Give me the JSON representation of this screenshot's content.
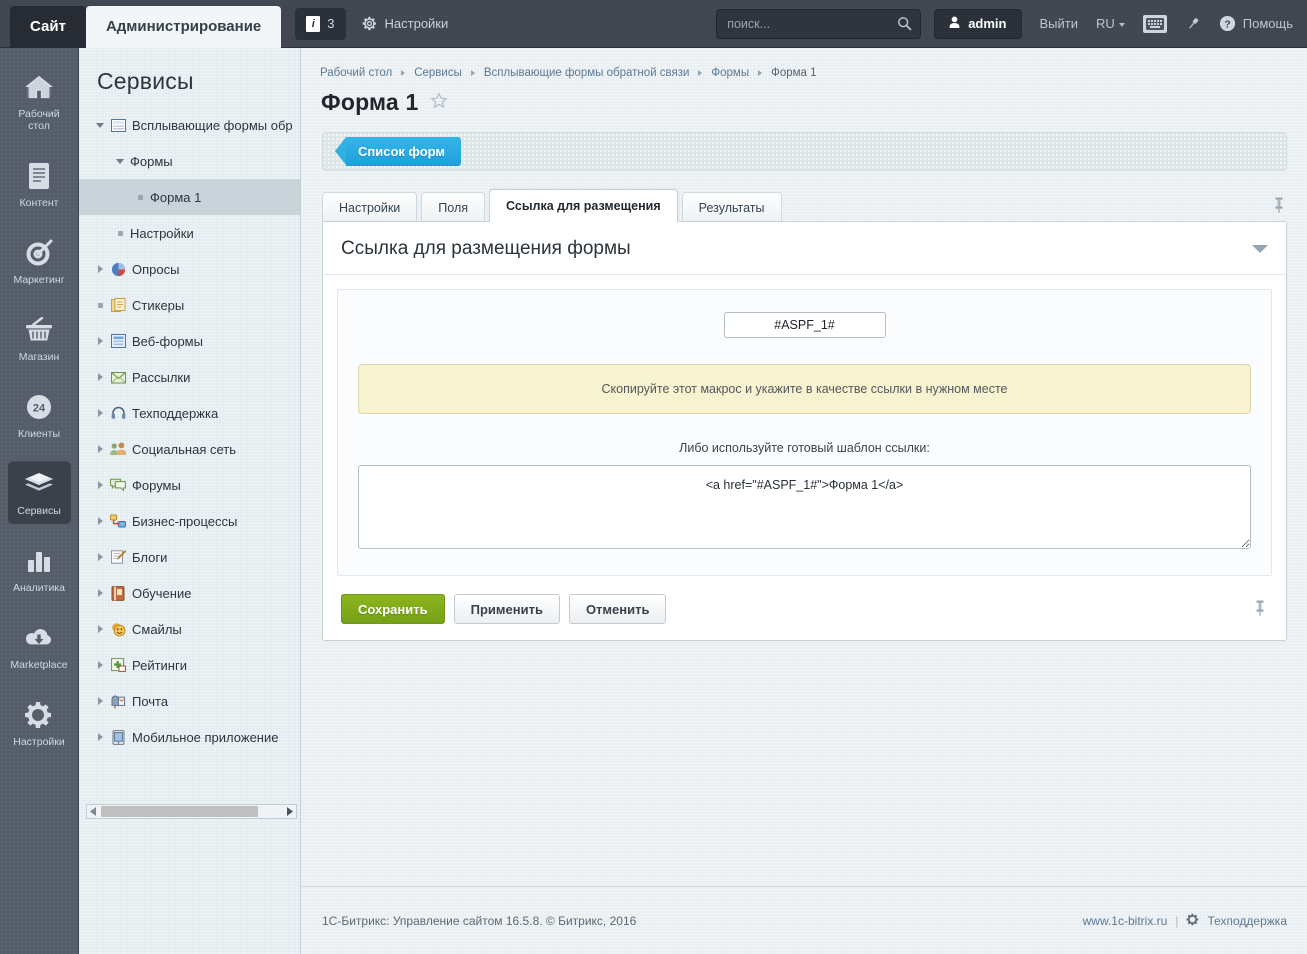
{
  "topbar": {
    "site_tab": "Сайт",
    "admin_tab": "Администрирование",
    "notify_count": "3",
    "notify_icon": "info-icon",
    "settings_label": "Настройки",
    "settings_icon": "gear-icon",
    "search_placeholder": "поиск...",
    "search_value": "",
    "search_icon": "search-icon",
    "user_label": "admin",
    "user_icon": "user-icon",
    "logout_label": "Выйти",
    "lang_label": "RU",
    "keyboard_icon": "keyboard-icon",
    "pin_icon": "pin-icon",
    "help_label": "Помощь",
    "help_icon": "question-circle-icon"
  },
  "rail": {
    "items": [
      {
        "label": "Рабочий стол",
        "icon": "home-icon",
        "active": false
      },
      {
        "label": "Контент",
        "icon": "document-icon",
        "active": false
      },
      {
        "label": "Маркетинг",
        "icon": "target-icon",
        "active": false
      },
      {
        "label": "Магазин",
        "icon": "basket-icon",
        "active": false
      },
      {
        "label": "Клиенты",
        "icon": "clients-24-icon",
        "active": false
      },
      {
        "label": "Сервисы",
        "icon": "layers-icon",
        "active": true
      },
      {
        "label": "Аналитика",
        "icon": "bar-chart-icon",
        "active": false
      },
      {
        "label": "Marketplace",
        "icon": "cloud-download-icon",
        "active": false
      },
      {
        "label": "Настройки",
        "icon": "gear-icon",
        "active": false
      }
    ]
  },
  "tree": {
    "title": "Сервисы",
    "nodes": [
      {
        "label": "Всплывающие формы обр",
        "marker": "down",
        "icon": "form-window-icon",
        "indent": 0,
        "selected": false
      },
      {
        "label": "Формы",
        "marker": "down",
        "icon": "none",
        "indent": 1,
        "selected": false
      },
      {
        "label": "Форма 1",
        "marker": "dot",
        "icon": "none",
        "indent": 2,
        "selected": true
      },
      {
        "label": "Настройки",
        "marker": "dot",
        "icon": "none",
        "indent": 1,
        "selected": false
      },
      {
        "label": "Опросы",
        "marker": "right",
        "icon": "pie-icon",
        "indent": 0,
        "selected": false
      },
      {
        "label": "Стикеры",
        "marker": "dot",
        "icon": "sticker-icon",
        "indent": 0,
        "selected": false
      },
      {
        "label": "Веб-формы",
        "marker": "right",
        "icon": "webform-icon",
        "indent": 0,
        "selected": false
      },
      {
        "label": "Рассылки",
        "marker": "right",
        "icon": "envelope-icon",
        "indent": 0,
        "selected": false
      },
      {
        "label": "Техподдержка",
        "marker": "right",
        "icon": "headset-icon",
        "indent": 0,
        "selected": false
      },
      {
        "label": "Социальная сеть",
        "marker": "right",
        "icon": "people-icon",
        "indent": 0,
        "selected": false
      },
      {
        "label": "Форумы",
        "marker": "right",
        "icon": "chat-icon",
        "indent": 0,
        "selected": false
      },
      {
        "label": "Бизнес-процессы",
        "marker": "right",
        "icon": "workflow-icon",
        "indent": 0,
        "selected": false
      },
      {
        "label": "Блоги",
        "marker": "right",
        "icon": "pencil-note-icon",
        "indent": 0,
        "selected": false
      },
      {
        "label": "Обучение",
        "marker": "right",
        "icon": "book-icon",
        "indent": 0,
        "selected": false
      },
      {
        "label": "Смайлы",
        "marker": "right",
        "icon": "smiley-icon",
        "indent": 0,
        "selected": false
      },
      {
        "label": "Рейтинги",
        "marker": "right",
        "icon": "plus-square-icon",
        "indent": 0,
        "selected": false
      },
      {
        "label": "Почта",
        "marker": "right",
        "icon": "mailbox-icon",
        "indent": 0,
        "selected": false
      },
      {
        "label": "Мобильное приложение",
        "marker": "right",
        "icon": "mobile-icon",
        "indent": 0,
        "selected": false
      }
    ],
    "scroll_left_icon": "triangle-left-icon",
    "scroll_right_icon": "triangle-right-icon"
  },
  "breadcrumb": [
    {
      "label": "Рабочий стол"
    },
    {
      "label": "Сервисы"
    },
    {
      "label": "Всплывающие формы обратной связи"
    },
    {
      "label": "Формы"
    },
    {
      "label": "Форма 1"
    }
  ],
  "page": {
    "title": "Форма 1",
    "favorite_icon": "star-outline-icon"
  },
  "toolbar": {
    "list_button": "Список форм"
  },
  "tabs": [
    {
      "label": "Настройки",
      "active": false
    },
    {
      "label": "Поля",
      "active": false
    },
    {
      "label": "Ссылка для размещения",
      "active": true
    },
    {
      "label": "Результаты",
      "active": false
    }
  ],
  "tabs_pin_icon": "pin-icon",
  "panel": {
    "heading": "Ссылка для размещения формы",
    "collapse_icon": "caret-down-icon",
    "macro_value": "#ASPF_1#",
    "notice": "Скопируйте этот макрос и укажите в качестве ссылки в нужном месте",
    "hint": "Либо используйте готовый шаблон ссылки:",
    "code_value": "<a href=\"#ASPF_1#\">Форма 1</a>"
  },
  "buttons": {
    "save": "Сохранить",
    "apply": "Применить",
    "cancel": "Отменить",
    "pin_icon": "pin-icon"
  },
  "footer": {
    "copyright": "1С-Битрикс: Управление сайтом 16.5.8. © Битрикс, 2016",
    "site_link": "www.1c-bitrix.ru",
    "separator": "|",
    "support_link": "Техподдержка",
    "support_icon": "gear-icon"
  },
  "colors": {
    "topbar_bg": "#40464f",
    "rail_bg": "#545d69",
    "tree_bg": "#e3ecef",
    "main_bg": "#e8eef1",
    "accent_blue": "#2fb1e4",
    "save_green": "#7fa81b",
    "notice_yellow": "#f7f2cf",
    "selected_row": "#c8d4da"
  }
}
